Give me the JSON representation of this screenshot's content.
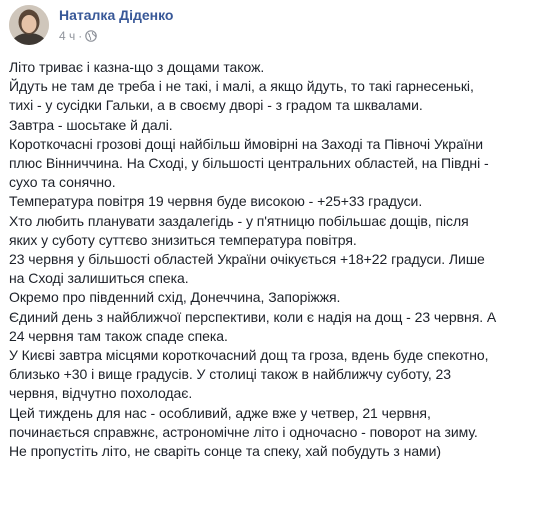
{
  "post": {
    "author": "Наталка Діденко",
    "time": "4 ч",
    "separator": "·",
    "privacy_icon": "globe-icon",
    "lines": [
      "Літо триває і казна-що з дощами також.",
      "Йдуть не там де треба і не такі, і малі, а якщо йдуть, то такі гарнесенькі,",
      "тихі - у сусідки Гальки, а в своєму дворі - з градом та шквалами.",
      "Завтра - шосьтаке й далі.",
      "Короткочасні грозові дощі найбільш ймовірні на Заході та Півночі України",
      "плюс Вінниччина. На Сході, у більшості центральних областей, на Півдні -",
      "сухо та сонячно.",
      "Температура повітря 19 червня буде високою - +25+33 градуси.",
      "Хто любить планувати заздалегідь - у п'ятницю побільшає дощів, після",
      "яких у суботу суттєво знизиться температура повітря.",
      "23 червня у більшості областей України очікується +18+22 градуси. Лише",
      "на Сході залишиться спека.",
      "Окремо про південний схід, Донеччина, Запоріжжя.",
      "Єдиний день з найближчої перспективи, коли є надія на дощ - 23 червня. А",
      "24 червня там також спаде спека.",
      "У Києві завтра місцями короткочасний дощ та гроза, вдень буде спекотно,",
      "близько +30 і вище градусів. У столиці також в найближчу суботу, 23",
      "червня, відчутно похолодає.",
      "Цей тиждень для нас - особливий, адже вже у четвер, 21 червня,",
      "починається справжнє, астрономічне літо і одночасно - поворот на зиму.",
      "Не пропустіть літо, не сваріть сонце та спеку, хай побудуть з нами)"
    ]
  }
}
